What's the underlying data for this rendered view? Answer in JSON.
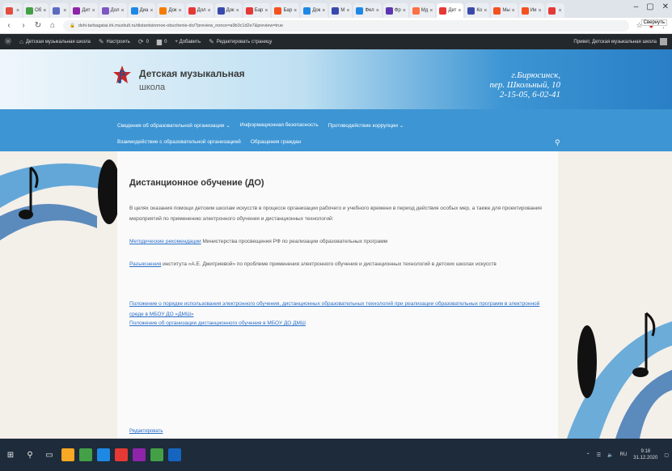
{
  "browser": {
    "tabs": [
      {
        "label": "",
        "color": "#e24d3d"
      },
      {
        "label": "Об",
        "color": "#43a047"
      },
      {
        "label": "",
        "color": "#5c6bc0"
      },
      {
        "label": "Дит",
        "color": "#8e24aa"
      },
      {
        "label": "Дол",
        "color": "#7e57c2"
      },
      {
        "label": "Диа",
        "color": "#1e88e5"
      },
      {
        "label": "Док",
        "color": "#f57c00"
      },
      {
        "label": "Дол",
        "color": "#e53935"
      },
      {
        "label": "Док",
        "color": "#3949ab"
      },
      {
        "label": "Бар",
        "color": "#e53935"
      },
      {
        "label": "Бар",
        "color": "#f4511e"
      },
      {
        "label": "Док",
        "color": "#1e88e5"
      },
      {
        "label": "М",
        "color": "#3949ab"
      },
      {
        "label": "Фел",
        "color": "#1e88e5"
      },
      {
        "label": "Фр",
        "color": "#5e35b1"
      },
      {
        "label": "Мд",
        "color": "#ff7043"
      },
      {
        "label": "Дет",
        "color": "#e53935",
        "active": true
      },
      {
        "label": "Ко",
        "color": "#3949ab"
      },
      {
        "label": "Мы",
        "color": "#f4511e"
      },
      {
        "label": "Ии",
        "color": "#f4511e"
      },
      {
        "label": "",
        "color": "#e53935"
      }
    ],
    "url": "dshi-tarbagatai.irk.muzkult.ru/distantsionnoe-obuchenie-do/?preview_nonce=a9b3c1d2e7&preview=true",
    "close_tooltip": "Свернуть"
  },
  "admin_bar": {
    "site_title": "Детская музыкальная школа",
    "customize": "Настроить",
    "comments_count": "0",
    "new_count": "0",
    "add_new": "+ Добавить",
    "edit_page": "Редактировать страницу",
    "greeting": "Привет, Детская музыкальная школа"
  },
  "header": {
    "school_line1": "Детская музыкальная",
    "school_line2": "школа",
    "address_line1": "г.Бирюсинск,",
    "address_line2": "пер. Школьный, 10",
    "address_line3": "2-15-05, 6-02-41"
  },
  "nav": {
    "row1": [
      "Сведения об образовательной организации  ⌄",
      "Информационная безопасность",
      "Противодействие коррупции  ⌄"
    ],
    "row2": [
      "Взаимодействие с образовательной организацией",
      "Обращения граждан"
    ]
  },
  "content": {
    "title": "Дистанционное обучение (ДО)",
    "p1": "В целях оказания помощи детским школам искусств в процессе организации рабочего и учебного времени в период действия особых мер, а также для проектирования мероприятий по применению электронного обучения и дистанционных технологий:",
    "p2_link": "Методические рекомендации",
    "p2_text": " Министерства просвещения РФ по реализации образовательных программ",
    "p3_link": "Разъяснения",
    "p3_text": " института «А.Е. Дмитриевой» по проблеме применения электронного обучения и дистанционных технологий в детских школах искусств",
    "p4_link": "Положение о порядке использования электронного обучения, дистанционных образовательных технологий при реализации образовательных программ в электронной среде в МБОУ ДО «ДМШ»",
    "p5_link": "Положение об организации дистанционного обучения в МБОУ ДО ДМШ",
    "footer_link": "Редактировать"
  },
  "taskbar": {
    "apps": [
      {
        "color": "#f9a825"
      },
      {
        "color": "#43a047"
      },
      {
        "color": "#1e88e5"
      },
      {
        "color": "#e53935"
      },
      {
        "color": "#8e24aa"
      },
      {
        "color": "#43a047"
      },
      {
        "color": "#1565c0"
      }
    ],
    "lang": "RU",
    "time": "9:18",
    "date": "31.12.2020"
  }
}
